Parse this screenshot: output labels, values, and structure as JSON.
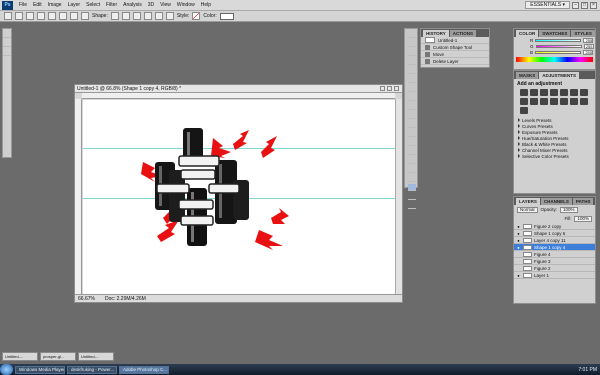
{
  "menubar": {
    "logo": "Ps",
    "items": [
      "File",
      "Edit",
      "Image",
      "Layer",
      "Select",
      "Filter",
      "Analysis",
      "3D",
      "View",
      "Window",
      "Help"
    ],
    "workspace": "ESSENTIALS ▾"
  },
  "options": {
    "shape_label": "Shape:",
    "style_label": "Style:",
    "color_label": "Color:"
  },
  "document": {
    "title": "Untitled-1 @ 66.8% (Shape 1 copy 4, RGB/8) *",
    "zoom": "66.67%",
    "doc_size": "Doc: 2.29M/4.26M"
  },
  "history": {
    "tabs": [
      "HISTORY",
      "ACTIONS"
    ],
    "items": [
      "Untitled-1",
      "Custom Shape Tool",
      "Move",
      "Delete Layer"
    ]
  },
  "color_panel": {
    "tabs": [
      "COLOR",
      "SWATCHES",
      "STYLES"
    ],
    "channels": [
      {
        "label": "R",
        "value": "255"
      },
      {
        "label": "G",
        "value": "255"
      },
      {
        "label": "B",
        "value": "255"
      }
    ]
  },
  "adjustments": {
    "tabs": [
      "MASKS",
      "ADJUSTMENTS"
    ],
    "heading": "Add an adjustment",
    "presets": [
      "Levels Presets",
      "Curves Presets",
      "Exposure Presets",
      "Hue/Saturation Presets",
      "Black & White Presets",
      "Channel Mixer Presets",
      "Selective Color Presets"
    ]
  },
  "layers": {
    "tabs": [
      "LAYERS",
      "CHANNELS",
      "PATHS"
    ],
    "blend_mode": "Normal",
    "opacity_label": "Opacity:",
    "opacity": "100%",
    "fill_label": "Fill:",
    "fill": "100%",
    "rows": [
      {
        "name": "Figure 2 copy",
        "selected": false
      },
      {
        "name": "Shape 1 copy 6",
        "selected": false
      },
      {
        "name": "Layer 4 copy 11",
        "selected": false
      },
      {
        "name": "Shape 1 copy 4",
        "selected": true
      },
      {
        "name": "Figure 4",
        "selected": false
      },
      {
        "name": "Figure 3",
        "selected": false
      },
      {
        "name": "Figure 2",
        "selected": false
      },
      {
        "name": "Layer 1",
        "selected": false
      }
    ]
  },
  "minimized_docs": [
    "Untitled-...",
    "prosper-gl...",
    "Untitled-..."
  ],
  "taskbar": {
    "items": [
      "Windows Media Player",
      "deskfruking - Power...",
      "Adobe Photoshop C..."
    ],
    "clock": "7:01 PM"
  },
  "colors": {
    "accent_selected": "#3d7edb",
    "guide": "#7fd6d3",
    "lightning": "#e81010"
  }
}
